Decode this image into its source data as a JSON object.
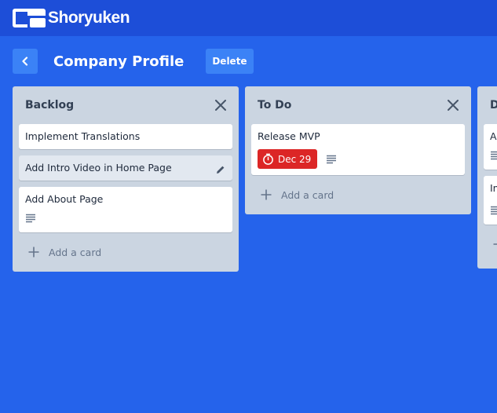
{
  "app": {
    "brand": "Shoryuken",
    "accent": "#2563eb",
    "topbar": "#1d4ed8"
  },
  "board": {
    "title": "Company Profile",
    "back_icon": "chevron-left-icon",
    "delete_label": "Delete"
  },
  "lists": [
    {
      "title": "Backlog",
      "cards": [
        {
          "title": "Implement Translations"
        },
        {
          "title": "Add Intro Video in Home Page",
          "state": "hovered"
        },
        {
          "title": "Add About Page",
          "has_description": true
        }
      ],
      "add_label": "Add a card"
    },
    {
      "title": "To Do",
      "cards": [
        {
          "title": "Release MVP",
          "due": "Dec 29",
          "due_color": "#dc2626",
          "has_description": true
        }
      ],
      "add_label": "Add a card"
    },
    {
      "title": "D",
      "cards": [
        {
          "title": "Ad",
          "has_description": true
        },
        {
          "title": "Im",
          "has_description": true
        }
      ]
    }
  ]
}
